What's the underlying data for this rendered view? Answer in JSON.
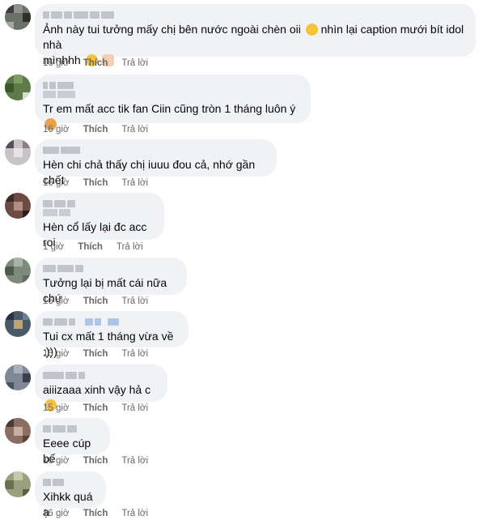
{
  "comments": [
    {
      "text": "Ảnh này tui tưởng mấy chị bên nước ngoài chèn oii 😭 nhìn lại caption mưới bít idol nhà mìnhhh 🥹🫶🏻",
      "line1": "Ảnh này tui tưởng mấy chị bên nước ngoài chèn oii",
      "line1_tail": "nhìn lại caption mưới bít idol nhà",
      "line2": "mìnhhh",
      "emoji": [
        "crying-face",
        "pleading-face",
        "hand-heart"
      ],
      "time": "16 giờ",
      "like": "Thích",
      "reply": "Trả lời"
    },
    {
      "text": "Tr em mất acc tik fan Ciin cũng tròn 1 tháng luôn ý",
      "emoji": [
        "facepalm"
      ],
      "time": "16 giờ",
      "like": "Thích",
      "reply": "Trả lời"
    },
    {
      "text": "Hèn chi chả thấy chị iuuu đou cả, nhớ gần chết",
      "time": "16 giờ",
      "like": "Thích",
      "reply": "Trả lời"
    },
    {
      "text": "Hèn cổ lấy lại đc acc roi",
      "time": "1 giờ",
      "like": "Thích",
      "reply": "Trả lời"
    },
    {
      "text": "Tưởng lại bị mất cái nữa chứ",
      "time": "16 giờ",
      "like": "Thích",
      "reply": "Trả lời"
    },
    {
      "text": "Tui cx mất 1 tháng vừa về :)))",
      "time": "15 giờ",
      "like": "Thích",
      "reply": "Trả lời"
    },
    {
      "text": "aiiizaaa xinh vậy hả c",
      "emoji": [
        "relieved-face"
      ],
      "time": "15 giờ",
      "like": "Thích",
      "reply": "Trả lời"
    },
    {
      "text": "Eeee cúp bế",
      "time": "16 giờ",
      "like": "Thích",
      "reply": "Trả lời"
    },
    {
      "text": "Xihkk quá ạ",
      "time": "16 giờ",
      "like": "Thích",
      "reply": "Trả lời"
    }
  ]
}
